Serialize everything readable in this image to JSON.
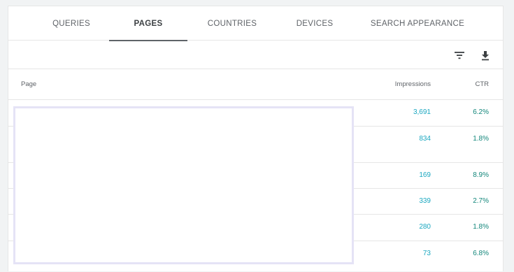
{
  "tabs": [
    {
      "label": "QUERIES"
    },
    {
      "label": "PAGES"
    },
    {
      "label": "COUNTRIES"
    },
    {
      "label": "DEVICES"
    },
    {
      "label": "SEARCH APPEARANCE"
    }
  ],
  "active_tab": "PAGES",
  "toolbar": {
    "filter_icon": "filter-icon",
    "download_icon": "download-icon"
  },
  "table": {
    "columns": {
      "page": "Page",
      "impressions": "Impressions",
      "ctr": "CTR"
    },
    "rows": [
      {
        "impressions": "3,691",
        "ctr": "6.2%"
      },
      {
        "impressions": "834",
        "ctr": "1.8%"
      },
      {
        "impressions": "169",
        "ctr": "8.9%"
      },
      {
        "impressions": "339",
        "ctr": "2.7%"
      },
      {
        "impressions": "280",
        "ctr": "1.8%"
      },
      {
        "impressions": "73",
        "ctr": "6.8%"
      }
    ]
  },
  "colors": {
    "impressions": "#1aa7c0",
    "ctr": "#12867a",
    "redaction_border": "#e5e3f6"
  }
}
